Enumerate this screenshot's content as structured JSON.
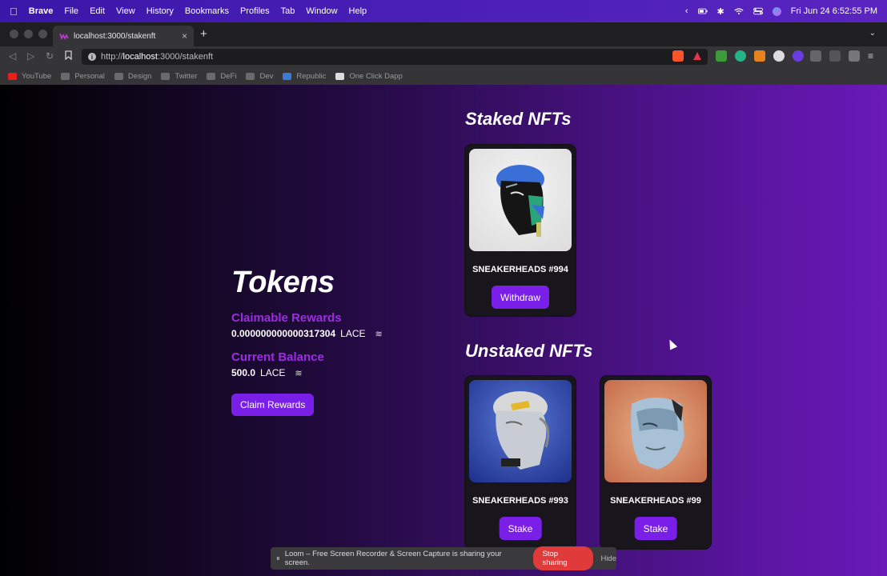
{
  "menubar": {
    "app": "Brave",
    "items": [
      "File",
      "Edit",
      "View",
      "History",
      "Bookmarks",
      "Profiles",
      "Tab",
      "Window",
      "Help"
    ],
    "datetime": "Fri Jun 24  6:52:55 PM"
  },
  "browser": {
    "tab_title": "localhost:3000/stakenft",
    "url_scheme": "http://",
    "url_host": "localhost",
    "url_path": ":3000/stakenft",
    "bookmarks": [
      "YouTube",
      "Personal",
      "Design",
      "Twitter",
      "DeFi",
      "Dev",
      "Republic",
      "One Click Dapp"
    ]
  },
  "tokens": {
    "title": "Tokens",
    "claimable_label": "Claimable Rewards",
    "claimable_value": "0.000000000000317304",
    "claimable_unit": "LACE",
    "balance_label": "Current Balance",
    "balance_value": "500.0",
    "balance_unit": "LACE",
    "claim_button": "Claim Rewards",
    "coin_icon": "≋"
  },
  "staked": {
    "title": "Staked NFTs",
    "items": [
      {
        "name": "SNEAKERHEADS #994",
        "button": "Withdraw"
      }
    ]
  },
  "unstaked": {
    "title": "Unstaked NFTs",
    "items": [
      {
        "name": "SNEAKERHEADS #993",
        "button": "Stake"
      },
      {
        "name": "SNEAKERHEADS #99",
        "button": "Stake"
      }
    ]
  },
  "loom": {
    "message": "Loom – Free Screen Recorder & Screen Capture is sharing your screen.",
    "stop": "Stop sharing",
    "hide": "Hide"
  },
  "colors": {
    "accent": "#7a1fe8",
    "label": "#9b2de0",
    "stop": "#e03a3a"
  }
}
